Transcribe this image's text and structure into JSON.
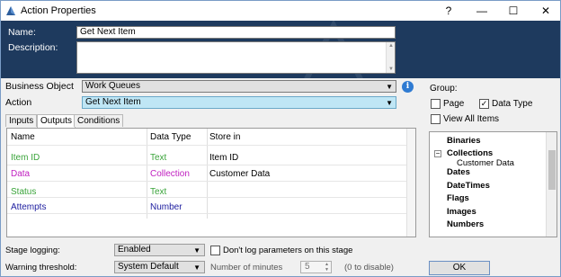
{
  "window": {
    "title": "Action Properties",
    "help_label": "?",
    "minimize_label": "—",
    "maximize_label": "☐",
    "close_label": "✕"
  },
  "header": {
    "name_label": "Name:",
    "name_value": "Get Next Item",
    "description_label": "Description:",
    "description_value": ""
  },
  "business_object": {
    "label": "Business Object",
    "value": "Work Queues"
  },
  "action": {
    "label": "Action",
    "value": "Get Next Item"
  },
  "tabs": [
    {
      "label": "Inputs"
    },
    {
      "label": "Outputs"
    },
    {
      "label": "Conditions"
    }
  ],
  "outputs_table": {
    "columns": [
      "Name",
      "Data Type",
      "Store in"
    ],
    "rows": [
      {
        "name": "Item ID",
        "data_type": "Text",
        "store_in": "Item ID",
        "color": "#3aa43a"
      },
      {
        "name": "Data",
        "data_type": "Collection",
        "store_in": "Customer Data",
        "color": "#c020c0"
      },
      {
        "name": "Status",
        "data_type": "Text",
        "store_in": "",
        "color": "#3aa43a"
      },
      {
        "name": "Attempts",
        "data_type": "Number",
        "store_in": "",
        "color": "#2020a0"
      }
    ]
  },
  "group_panel": {
    "title": "Group:",
    "page_label": "Page",
    "page_checked": false,
    "data_type_label": "Data Type",
    "data_type_checked": true,
    "view_all_label": "View All Items",
    "view_all_checked": false
  },
  "tree": {
    "items": [
      {
        "label": "Binaries",
        "type": "node"
      },
      {
        "label": "Collections",
        "type": "node-expanded"
      },
      {
        "label": "Customer Data",
        "type": "leaf"
      },
      {
        "label": "Dates",
        "type": "node"
      },
      {
        "label": "DateTimes",
        "type": "node"
      },
      {
        "label": "Flags",
        "type": "node"
      },
      {
        "label": "Images",
        "type": "node"
      },
      {
        "label": "Numbers",
        "type": "node"
      }
    ]
  },
  "footer": {
    "stage_logging_label": "Stage logging:",
    "stage_logging_value": "Enabled",
    "dont_log_label": "Don't log parameters on this stage",
    "warning_threshold_label": "Warning threshold:",
    "warning_threshold_value": "System Default",
    "minutes_label": "Number of minutes",
    "minutes_value": "5",
    "disable_hint": "(0 to disable)",
    "ok_label": "OK"
  }
}
